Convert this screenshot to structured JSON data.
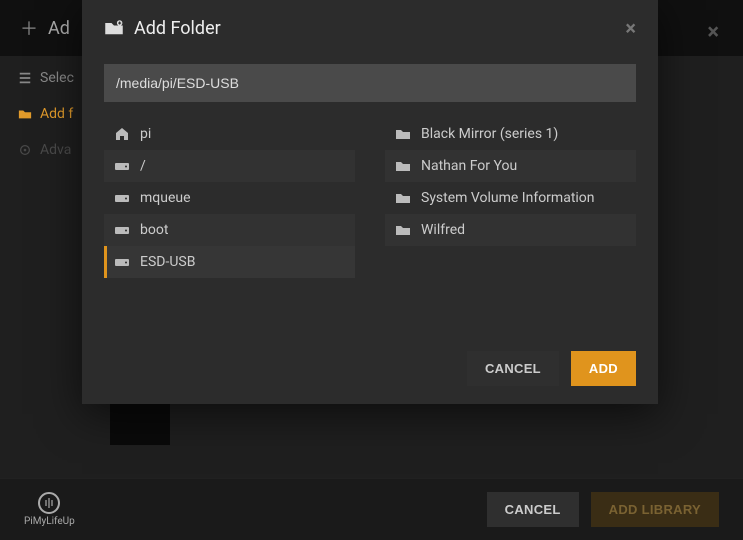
{
  "bg": {
    "title_prefix": "Ad",
    "close_icon": "×",
    "side": {
      "select": "Selec",
      "add": "Add f",
      "adv": "Adva"
    },
    "footer": {
      "logo": "PiMyLifeUp",
      "cancel": "CANCEL",
      "add_library": "ADD LIBRARY"
    }
  },
  "modal": {
    "title": "Add Folder",
    "path": "/media/pi/ESD-USB",
    "close_icon": "×",
    "left": [
      {
        "icon": "home",
        "label": "pi",
        "shade": false,
        "selected": false
      },
      {
        "icon": "drive",
        "label": "/",
        "shade": true,
        "selected": false
      },
      {
        "icon": "drive",
        "label": "mqueue",
        "shade": false,
        "selected": false
      },
      {
        "icon": "drive",
        "label": "boot",
        "shade": true,
        "selected": false
      },
      {
        "icon": "drive",
        "label": "ESD-USB",
        "shade": false,
        "selected": true
      }
    ],
    "right": [
      {
        "icon": "folder",
        "label": "Black Mirror (series 1)",
        "shade": false
      },
      {
        "icon": "folder",
        "label": "Nathan For You",
        "shade": true
      },
      {
        "icon": "folder",
        "label": "System Volume Information",
        "shade": false
      },
      {
        "icon": "folder",
        "label": "Wilfred",
        "shade": true
      }
    ],
    "cancel": "CANCEL",
    "add": "ADD"
  },
  "colors": {
    "accent": "#e0941d"
  }
}
